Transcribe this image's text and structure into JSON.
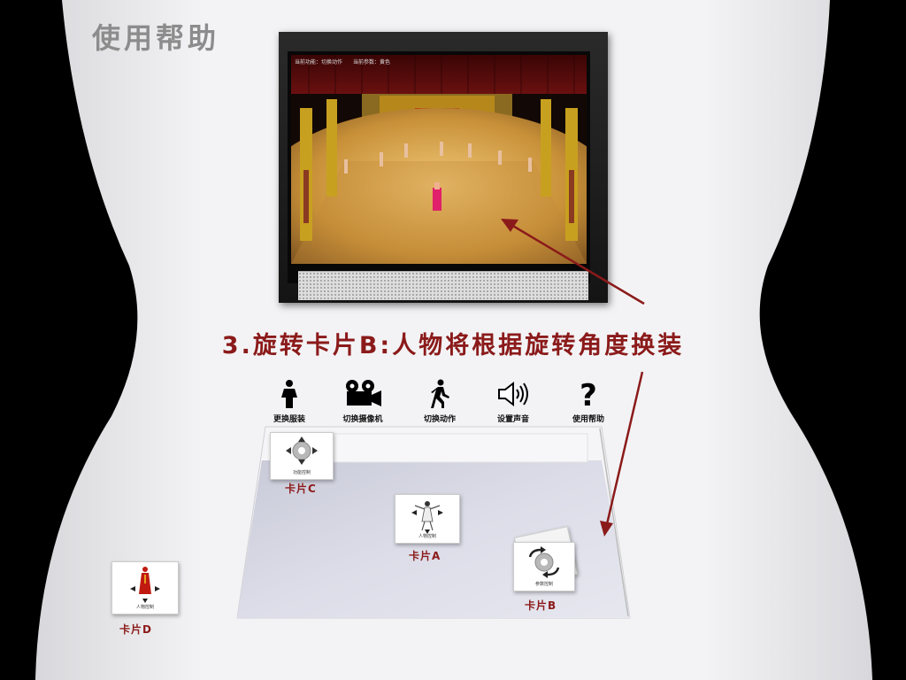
{
  "title": "使用帮助",
  "monitor": {
    "status": {
      "function": "当前功能：切换动作",
      "param": "当前参数：黄色"
    }
  },
  "caption": "3.旋转卡片B:人物将根据旋转角度换装",
  "toolbar": [
    {
      "label": "更换服装",
      "icon": "person-icon"
    },
    {
      "label": "切换摄像机",
      "icon": "camera-icon"
    },
    {
      "label": "切换动作",
      "icon": "walking-person-icon"
    },
    {
      "label": "设置声音",
      "icon": "speaker-icon"
    },
    {
      "label": "使用帮助",
      "icon": "question-icon"
    }
  ],
  "cards": {
    "c": {
      "label": "卡片C",
      "caption": "功能控制",
      "icon": "gear-icon"
    },
    "a": {
      "label": "卡片A",
      "caption": "人物控制",
      "icon": "dancer-icon"
    },
    "b": {
      "label": "卡片B",
      "caption": "参数控制",
      "icon": "rotate-gear-icon"
    },
    "d": {
      "label": "卡片D",
      "caption": "人物控制",
      "icon": "figure-icon"
    }
  },
  "colors": {
    "accent": "#8b1a1a",
    "wall": "#f2f2f4",
    "mat": "#d8d9e6"
  }
}
